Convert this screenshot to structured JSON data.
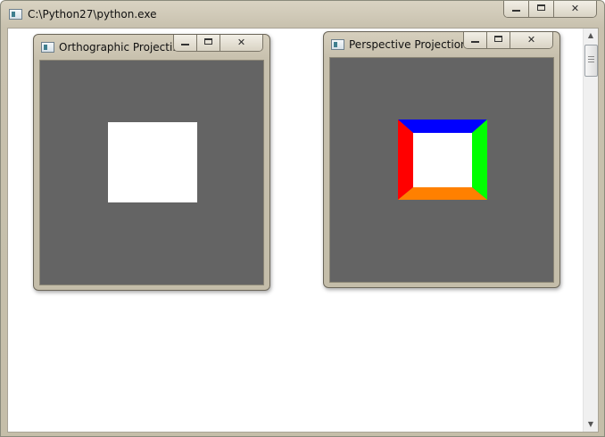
{
  "main_window": {
    "title": "C:\\Python27\\python.exe",
    "icon": "window-app-icon"
  },
  "ortho_window": {
    "title": "Orthographic Projecti...",
    "icon": "window-app-icon",
    "canvas_bg": "#646464",
    "square_color": "#ffffff"
  },
  "persp_window": {
    "title": "Perspective Projection",
    "icon": "window-app-icon",
    "canvas_bg": "#646464",
    "faces": {
      "top": "#0000ff",
      "left": "#ff0000",
      "right": "#00ff00",
      "bottom": "#ff8000",
      "front": "#ffffff"
    }
  },
  "caption_buttons": {
    "minimize": "minimize-icon",
    "maximize": "maximize-icon",
    "close": "close-icon",
    "close_glyph": "✕"
  },
  "scrollbar": {
    "up_arrow": "▲",
    "down_arrow": "▼"
  }
}
